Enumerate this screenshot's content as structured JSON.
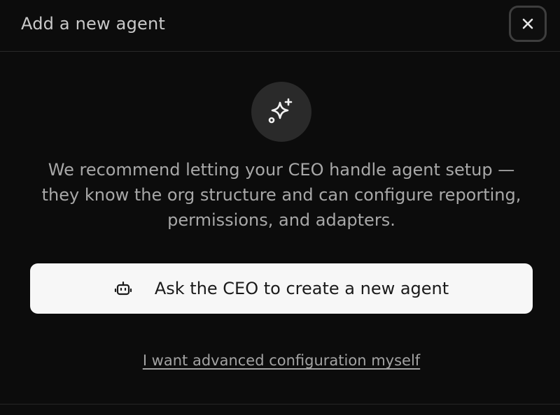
{
  "dialog": {
    "title": "Add a new agent",
    "close_icon": "close-icon",
    "hero_icon": "sparkles-icon",
    "description": "We recommend letting your CEO handle agent setup — they know the org structure and can configure reporting, permissions, and adapters.",
    "primary_action": {
      "icon": "bot-icon",
      "label": "Ask the CEO to create a new agent"
    },
    "secondary_link": "I want advanced configuration myself"
  },
  "colors": {
    "background": "#0c0c0c",
    "button_bg": "#f7f7f7",
    "text_muted": "#a8a8a8"
  }
}
